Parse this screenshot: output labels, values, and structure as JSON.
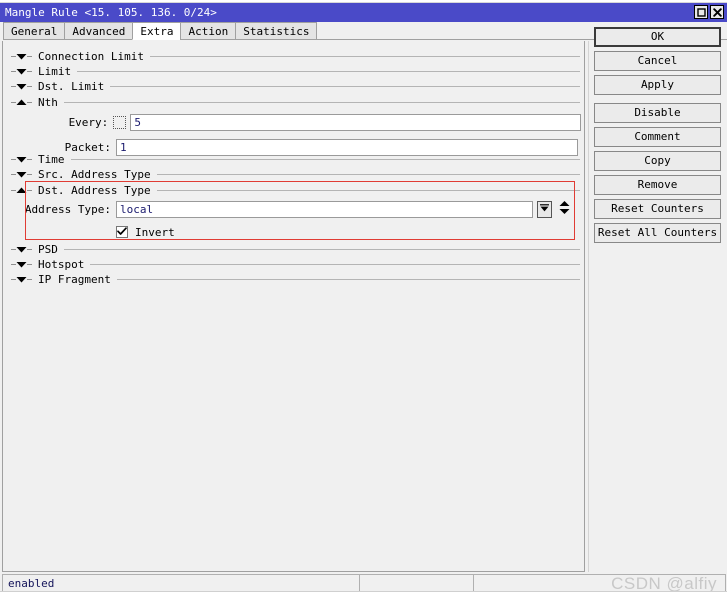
{
  "window": {
    "title": "Mangle Rule <15. 105. 136. 0/24>",
    "maximize_icon": "maximize-icon",
    "close_icon": "close-icon"
  },
  "tabs": [
    {
      "label": "General",
      "active": false
    },
    {
      "label": "Advanced",
      "active": false
    },
    {
      "label": "Extra",
      "active": true
    },
    {
      "label": "Action",
      "active": false
    },
    {
      "label": "Statistics",
      "active": false
    }
  ],
  "groups": [
    {
      "label": "Connection Limit",
      "expanded": false,
      "arrow": "chevron-down-icon"
    },
    {
      "label": "Limit",
      "expanded": false,
      "arrow": "chevron-down-icon"
    },
    {
      "label": "Dst. Limit",
      "expanded": false,
      "arrow": "chevron-down-icon"
    },
    {
      "label": "Nth",
      "expanded": true,
      "arrow": "chevron-up-icon"
    },
    {
      "label": "Time",
      "expanded": false,
      "arrow": "chevron-down-icon"
    },
    {
      "label": "Src. Address Type",
      "expanded": false,
      "arrow": "chevron-down-icon"
    },
    {
      "label": "Dst. Address Type",
      "expanded": true,
      "arrow": "chevron-up-icon"
    },
    {
      "label": "PSD",
      "expanded": false,
      "arrow": "chevron-down-icon"
    },
    {
      "label": "Hotspot",
      "expanded": false,
      "arrow": "chevron-down-icon"
    },
    {
      "label": "IP Fragment",
      "expanded": false,
      "arrow": "chevron-down-icon"
    }
  ],
  "nth": {
    "every_label": "Every:",
    "every_value": "5",
    "every_placeholder": "",
    "packet_label": "Packet:",
    "packet_value": "1",
    "packet_placeholder": ""
  },
  "dst_address_type": {
    "address_type_label": "Address Type:",
    "address_type_value": "local",
    "address_type_placeholder": "",
    "dropdown_icon": "chevron-down-filled-icon",
    "spinner_icon": "spinner-updown-icon",
    "invert_label": "Invert",
    "invert_checked": true,
    "highlight_color": "#e03c34"
  },
  "buttons": [
    {
      "label": "OK",
      "primary": true
    },
    {
      "label": "Cancel",
      "primary": false
    },
    {
      "label": "Apply",
      "primary": false
    },
    {
      "label": "Disable",
      "primary": false
    },
    {
      "label": "Comment",
      "primary": false
    },
    {
      "label": "Copy",
      "primary": false
    },
    {
      "label": "Remove",
      "primary": false
    },
    {
      "label": "Reset Counters",
      "primary": false
    },
    {
      "label": "Reset All Counters",
      "primary": false
    }
  ],
  "statusbar": {
    "state": "enabled",
    "cell2": "",
    "cell3": ""
  },
  "watermark": "CSDN @alfiy",
  "colors": {
    "titlebar": "#4a4ac8",
    "panel": "#f0f0f0",
    "highlight": "#e03c34",
    "field_text": "#1a1a6e"
  }
}
